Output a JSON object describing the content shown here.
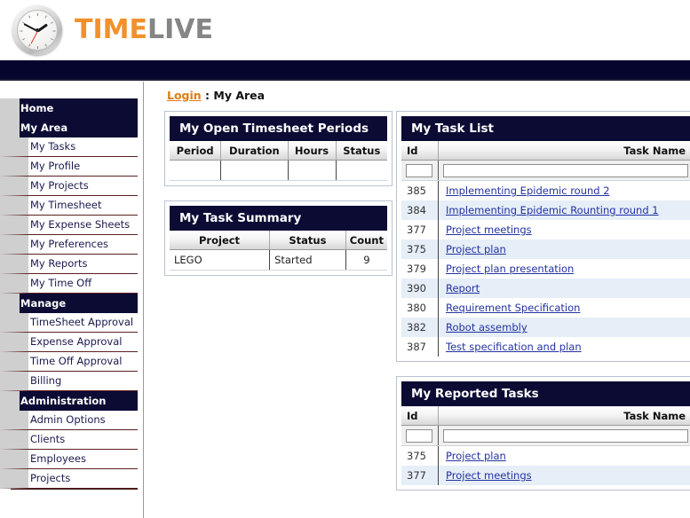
{
  "brand": {
    "name_part1": "TIME",
    "name_part2": "LIVE",
    "clock_icon": "analog-clock-icon",
    "color_orange": "#f2912b",
    "color_gray": "#858585"
  },
  "theme": {
    "navy": "#0b0b34",
    "topbar": "#05052e",
    "link_blue": "#2232a0",
    "link_orange": "#e07b10",
    "row_alt": "#e6eef8"
  },
  "breadcrumb": {
    "link": "Login",
    "separator": " : ",
    "current": "My Area"
  },
  "sidebar": {
    "groups": [
      {
        "label": "Home",
        "items": []
      },
      {
        "label": "My Area",
        "items": [
          {
            "label": "My Tasks"
          },
          {
            "label": "My Profile"
          },
          {
            "label": "My Projects"
          },
          {
            "label": "My Timesheet"
          },
          {
            "label": "My Expense Sheets"
          },
          {
            "label": "My Preferences"
          },
          {
            "label": "My Reports"
          },
          {
            "label": "My Time Off"
          }
        ]
      },
      {
        "label": "Manage",
        "items": [
          {
            "label": "TimeSheet Approval"
          },
          {
            "label": "Expense Approval"
          },
          {
            "label": "Time Off Approval"
          },
          {
            "label": "Billing"
          }
        ]
      },
      {
        "label": "Administration",
        "items": [
          {
            "label": "Admin Options"
          },
          {
            "label": "Clients"
          },
          {
            "label": "Employees"
          },
          {
            "label": "Projects"
          }
        ]
      }
    ]
  },
  "panels": {
    "open_timesheet_periods": {
      "title": "My Open Timesheet Periods",
      "columns": [
        "Period",
        "Duration",
        "Hours",
        "Status"
      ],
      "rows": [
        [
          "",
          "",
          "",
          ""
        ]
      ]
    },
    "task_summary": {
      "title": "My Task Summary",
      "columns": [
        "Project",
        "Status",
        "Count"
      ],
      "rows": [
        [
          "LEGO",
          "Started",
          "9"
        ]
      ]
    },
    "task_list": {
      "title": "My Task List",
      "columns": [
        "Id",
        "Task Name"
      ],
      "filters": {
        "id_value": "",
        "name_value": ""
      },
      "rows": [
        {
          "id": "385",
          "name": "Implementing Epidemic round 2"
        },
        {
          "id": "384",
          "name": "Implementing Epidemic Rounting round 1"
        },
        {
          "id": "377",
          "name": "Project meetings"
        },
        {
          "id": "375",
          "name": "Project plan"
        },
        {
          "id": "379",
          "name": "Project plan presentation"
        },
        {
          "id": "390",
          "name": "Report"
        },
        {
          "id": "380",
          "name": "Requirement Specification"
        },
        {
          "id": "382",
          "name": "Robot assembly"
        },
        {
          "id": "387",
          "name": "Test specification and plan"
        }
      ]
    },
    "reported_tasks": {
      "title": "My Reported Tasks",
      "columns": [
        "Id",
        "Task Name"
      ],
      "filters": {
        "id_value": "",
        "name_value": ""
      },
      "rows": [
        {
          "id": "375",
          "name": "Project plan"
        },
        {
          "id": "377",
          "name": "Project meetings"
        }
      ]
    }
  }
}
